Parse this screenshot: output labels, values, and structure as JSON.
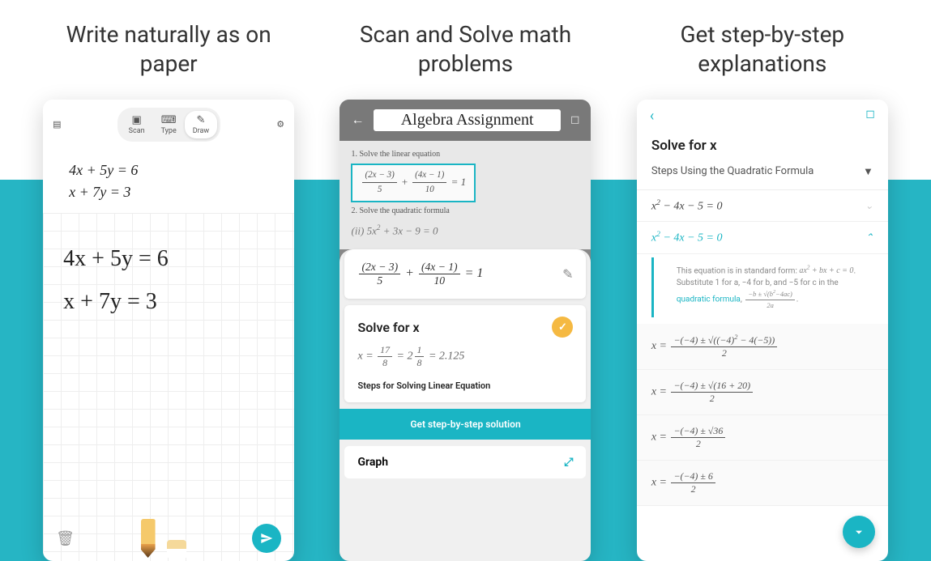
{
  "headlines": {
    "panel1": "Write naturally as on paper",
    "panel2": "Scan and Solve math problems",
    "panel3": "Get step-by-step explanations"
  },
  "panel1": {
    "modes": {
      "scan": "Scan",
      "type": "Type",
      "draw": "Draw"
    },
    "typed_line1": "4x + 5y = 6",
    "typed_line2": "x + 7y = 3",
    "hand_line1": "4x + 5y = 6",
    "hand_line2": "x + 7y = 3"
  },
  "panel2": {
    "title": "Algebra Assignment",
    "scan_line1": "1. Solve the linear equation",
    "scan_eq1": "(i)  (2x−3)/5 + (4x−1)/10 = 1",
    "scan_line2": "2. Solve the quadratic formula",
    "scan_eq2": "(ii) 5x² + 3x − 9 = 0",
    "detected_eq": "(2x−3)/5 + (4x−1)/10 = 1",
    "solve_title": "Solve for x",
    "result": "x = 17/8 = 2 1/8 = 2.125",
    "steps_label": "Steps for Solving Linear Equation",
    "cta": "Get step-by-step solution",
    "graph": "Graph"
  },
  "panel3": {
    "title": "Solve for x",
    "dropdown": "Steps Using the Quadratic Formula",
    "step1": "x² − 4x − 5 = 0",
    "step2": "x² − 4x − 5 = 0",
    "explain_pre": "This equation is in standard form: ",
    "explain_formula": "ax² + bx + c = 0",
    "explain_mid": ". Substitute 1 for a, −4 for b, and −5 for c in the ",
    "explain_link": "quadratic formula",
    "explain_post": ", (−b ± √(b²−4ac)) / 2a.",
    "work1": "x = (−(−4) ± √((−4)² − 4(−5))) / 2",
    "work2": "x = (−(−4) ± √(16 + 20)) / 2",
    "work3": "x = (−(−4) ± √36) / 2",
    "work4": "x = (−(−4) ± 6) / 2"
  }
}
